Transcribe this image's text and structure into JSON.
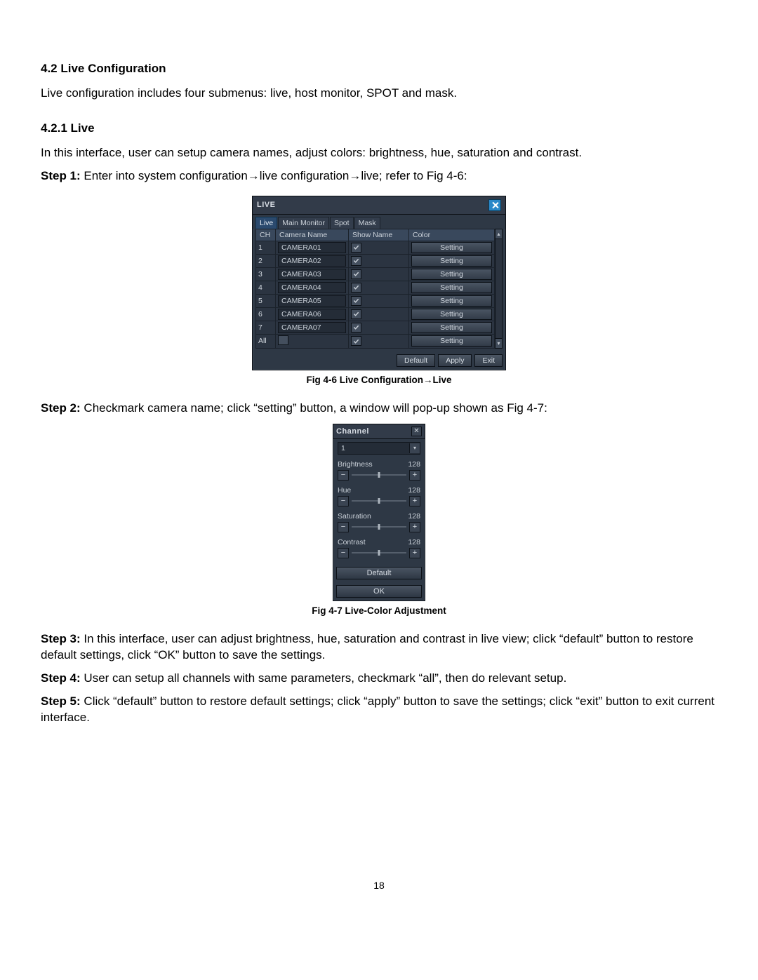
{
  "headings": {
    "s42": "4.2 Live Configuration",
    "s421": "4.2.1 Live"
  },
  "para": {
    "intro42": "Live configuration includes four submenus: live, host monitor, SPOT and mask.",
    "intro421": "In this interface, user can setup camera names, adjust colors: brightness, hue, saturation and contrast.",
    "step1_label": "Step 1:",
    "step1": " Enter into system configuration→live configuration→live; refer to Fig 4-6:",
    "fig46": "Fig 4-6 Live Configuration→Live",
    "step2_label": "Step 2:",
    "step2": " Checkmark camera name; click “setting” button, a window will pop-up shown as Fig 4-7:",
    "fig47": "Fig 4-7 Live-Color Adjustment",
    "step3_label": "Step 3:",
    "step3": " In this interface, user can adjust brightness, hue, saturation and contrast in live view; click “default” button to restore default settings, click “OK” button to save the settings.",
    "step4_label": "Step 4:",
    "step4": " User can setup all channels with same parameters, checkmark “all”, then do relevant setup.",
    "step5_label": "Step 5:",
    "step5": " Click “default” button to restore default settings; click “apply” button to save the settings; click “exit” button to exit current interface.",
    "pagenum": "18"
  },
  "win1": {
    "title": "LIVE",
    "tabs": [
      "Live",
      "Main Monitor",
      "Spot",
      "Mask"
    ],
    "headers": {
      "ch": "CH",
      "camera": "Camera Name",
      "show": "Show Name",
      "color": "Color"
    },
    "rows": [
      {
        "ch": "1",
        "name": "CAMERA01",
        "setting": "Setting"
      },
      {
        "ch": "2",
        "name": "CAMERA02",
        "setting": "Setting"
      },
      {
        "ch": "3",
        "name": "CAMERA03",
        "setting": "Setting"
      },
      {
        "ch": "4",
        "name": "CAMERA04",
        "setting": "Setting"
      },
      {
        "ch": "5",
        "name": "CAMERA05",
        "setting": "Setting"
      },
      {
        "ch": "6",
        "name": "CAMERA06",
        "setting": "Setting"
      },
      {
        "ch": "7",
        "name": "CAMERA07",
        "setting": "Setting"
      }
    ],
    "all_label": "All",
    "all_setting": "Setting",
    "footer": {
      "default": "Default",
      "apply": "Apply",
      "exit": "Exit"
    }
  },
  "win2": {
    "title": "Channel",
    "channel_value": "1",
    "params": [
      {
        "label": "Brightness",
        "value": "128"
      },
      {
        "label": "Hue",
        "value": "128"
      },
      {
        "label": "Saturation",
        "value": "128"
      },
      {
        "label": "Contrast",
        "value": "128"
      }
    ],
    "default": "Default",
    "ok": "OK",
    "minus": "−",
    "plus": "+"
  }
}
